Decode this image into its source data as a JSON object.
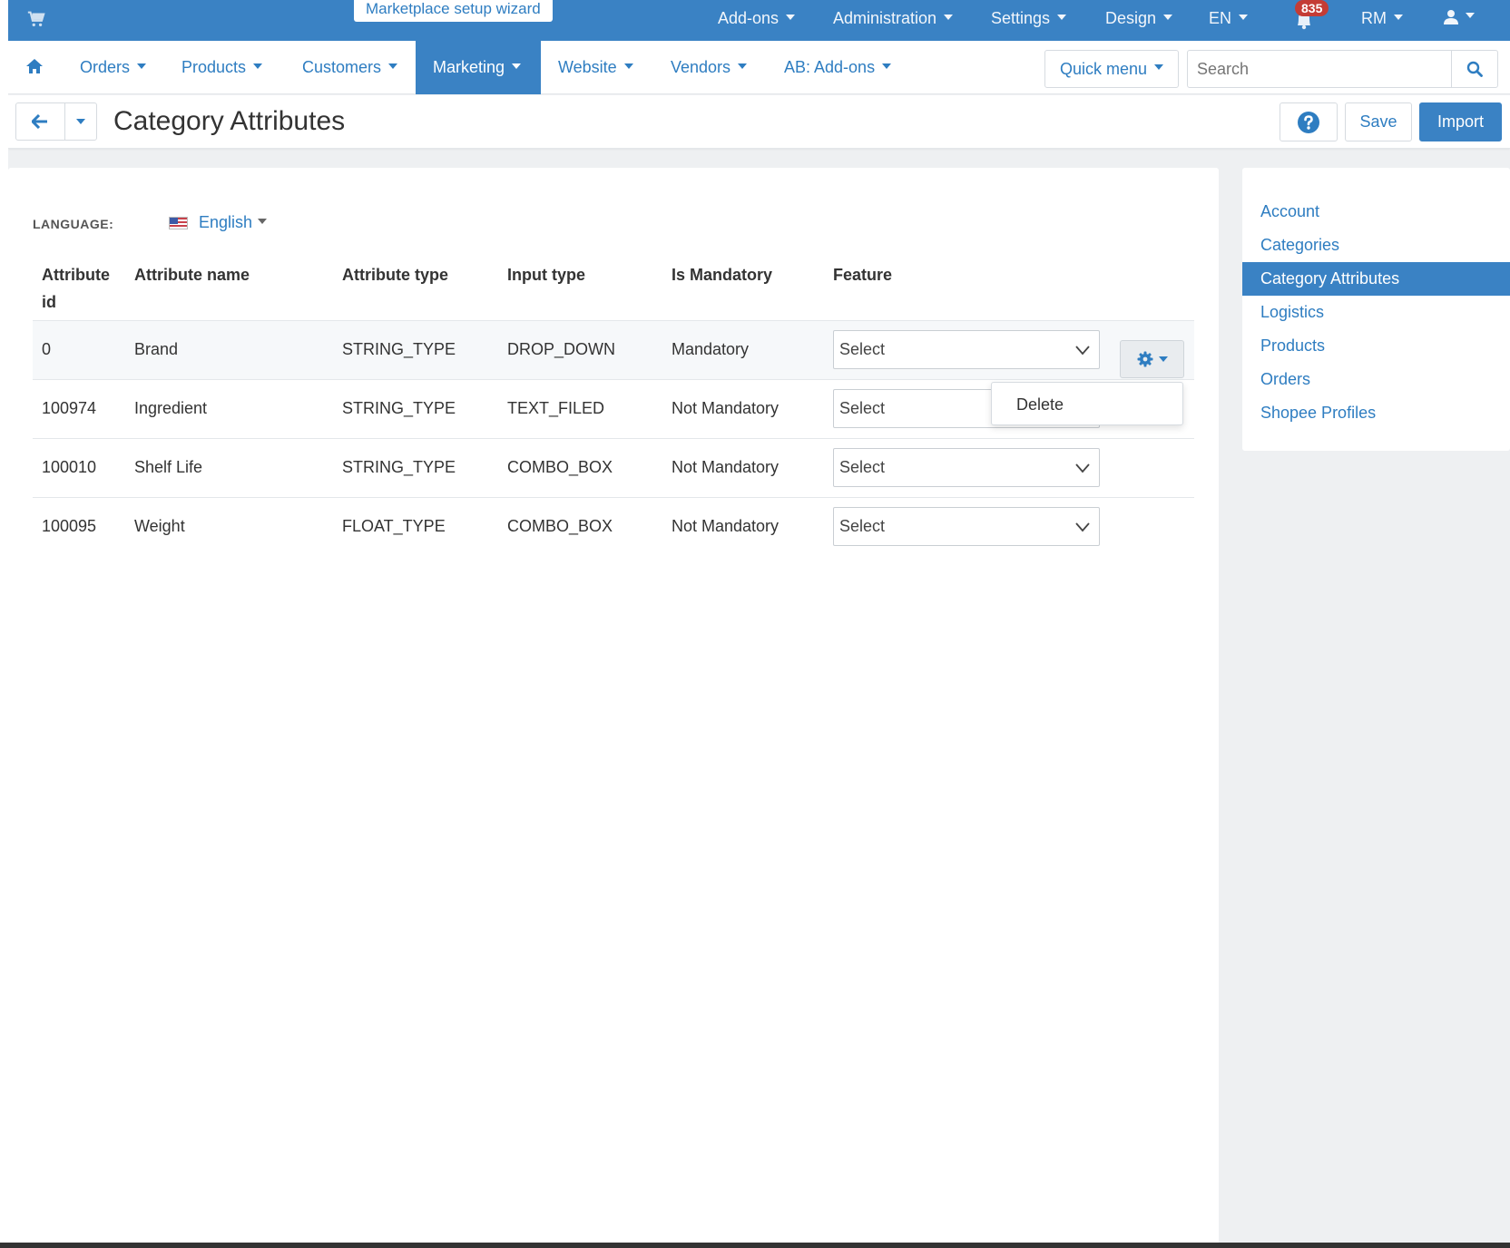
{
  "topbar": {
    "wizard_label": "Marketplace setup wizard",
    "items": [
      {
        "label": "Add-ons"
      },
      {
        "label": "Administration"
      },
      {
        "label": "Settings"
      },
      {
        "label": "Design"
      },
      {
        "label": "EN"
      },
      {
        "label": "RM"
      }
    ],
    "notification_count": "835",
    "icons": [
      "cart-icon",
      "bell-icon",
      "user-icon"
    ]
  },
  "mainnav": {
    "items": [
      {
        "label": "Orders"
      },
      {
        "label": "Products"
      },
      {
        "label": "Customers"
      },
      {
        "label": "Marketing"
      },
      {
        "label": "Website"
      },
      {
        "label": "Vendors"
      },
      {
        "label": "AB: Add-ons"
      }
    ],
    "active": "Marketing",
    "quick_menu_label": "Quick menu",
    "search_placeholder": "Search"
  },
  "titlebar": {
    "title": "Category Attributes",
    "save_label": "Save",
    "import_label": "Import"
  },
  "language": {
    "label": "LANGUAGE:",
    "value": "English"
  },
  "table": {
    "headers": {
      "id_line1": "Attribute",
      "id_line2": "id",
      "name": "Attribute name",
      "type": "Attribute type",
      "input": "Input type",
      "mandatory": "Is Mandatory",
      "feature": "Feature"
    },
    "rows": [
      {
        "id": "0",
        "name": "Brand",
        "type": "STRING_TYPE",
        "input": "DROP_DOWN",
        "mandatory": "Mandatory",
        "feature": "Select"
      },
      {
        "id": "100974",
        "name": "Ingredient",
        "type": "STRING_TYPE",
        "input": "TEXT_FILED",
        "mandatory": "Not Mandatory",
        "feature": "Select"
      },
      {
        "id": "100010",
        "name": "Shelf Life",
        "type": "STRING_TYPE",
        "input": "COMBO_BOX",
        "mandatory": "Not Mandatory",
        "feature": "Select"
      },
      {
        "id": "100095",
        "name": "Weight",
        "type": "FLOAT_TYPE",
        "input": "COMBO_BOX",
        "mandatory": "Not Mandatory",
        "feature": "Select"
      }
    ]
  },
  "dropdown": {
    "delete_label": "Delete"
  },
  "sidebar": {
    "items": [
      {
        "label": "Account"
      },
      {
        "label": "Categories"
      },
      {
        "label": "Category Attributes"
      },
      {
        "label": "Logistics"
      },
      {
        "label": "Products"
      },
      {
        "label": "Orders"
      },
      {
        "label": "Shopee Profiles"
      }
    ],
    "active": "Category Attributes"
  },
  "colors": {
    "brand_blue": "#3a82c4",
    "link_blue": "#2e7dc1",
    "badge_red": "#c43c35",
    "background": "#eef0f2"
  }
}
